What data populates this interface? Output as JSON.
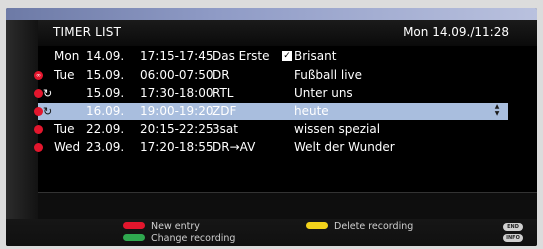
{
  "header": {
    "title": "TIMER LIST",
    "datetime": "Mon 14.09./11:28"
  },
  "rows": [
    {
      "indicator": "none",
      "repeat": "",
      "day": "Mon",
      "date": "14.09.",
      "time": "17:15-17:45",
      "channel": "Das Erste",
      "title": "Brisant",
      "checked": true,
      "selected": false
    },
    {
      "indicator": "badge",
      "repeat": "",
      "day": "Tue",
      "date": "15.09.",
      "time": "06:00-07:50",
      "channel": "DR",
      "title": "Fußball live",
      "checked": false,
      "selected": false
    },
    {
      "indicator": "dot",
      "repeat": "↻",
      "day": "",
      "date": "15.09.",
      "time": "17:30-18:00",
      "channel": "RTL",
      "title": "Unter uns",
      "checked": false,
      "selected": false
    },
    {
      "indicator": "dot",
      "repeat": "↻",
      "day": "",
      "date": "16.09.",
      "time": "19:00-19:20",
      "channel": "ZDF",
      "title": "heute",
      "checked": false,
      "selected": true
    },
    {
      "indicator": "dot",
      "repeat": "",
      "day": "Tue",
      "date": "22.09.",
      "time": "20:15-22:25",
      "channel": "3sat",
      "title": "wissen spezial",
      "checked": false,
      "selected": false
    },
    {
      "indicator": "dot",
      "repeat": "",
      "day": "Wed",
      "date": "23.09.",
      "time": "17:20-18:55",
      "channel": "DR→AV",
      "title": "Welt der Wunder",
      "checked": false,
      "selected": false
    }
  ],
  "footer": {
    "new_entry": "New entry",
    "change_recording": "Change recording",
    "delete_recording": "Delete recording",
    "end_key": "END",
    "info_key": "INFO"
  },
  "colors": {
    "red_key": "#e3162d",
    "green_key": "#2fa84f",
    "yellow_key": "#f2d21b",
    "selection": "#a9bede",
    "record_dot": "#e3162d"
  }
}
